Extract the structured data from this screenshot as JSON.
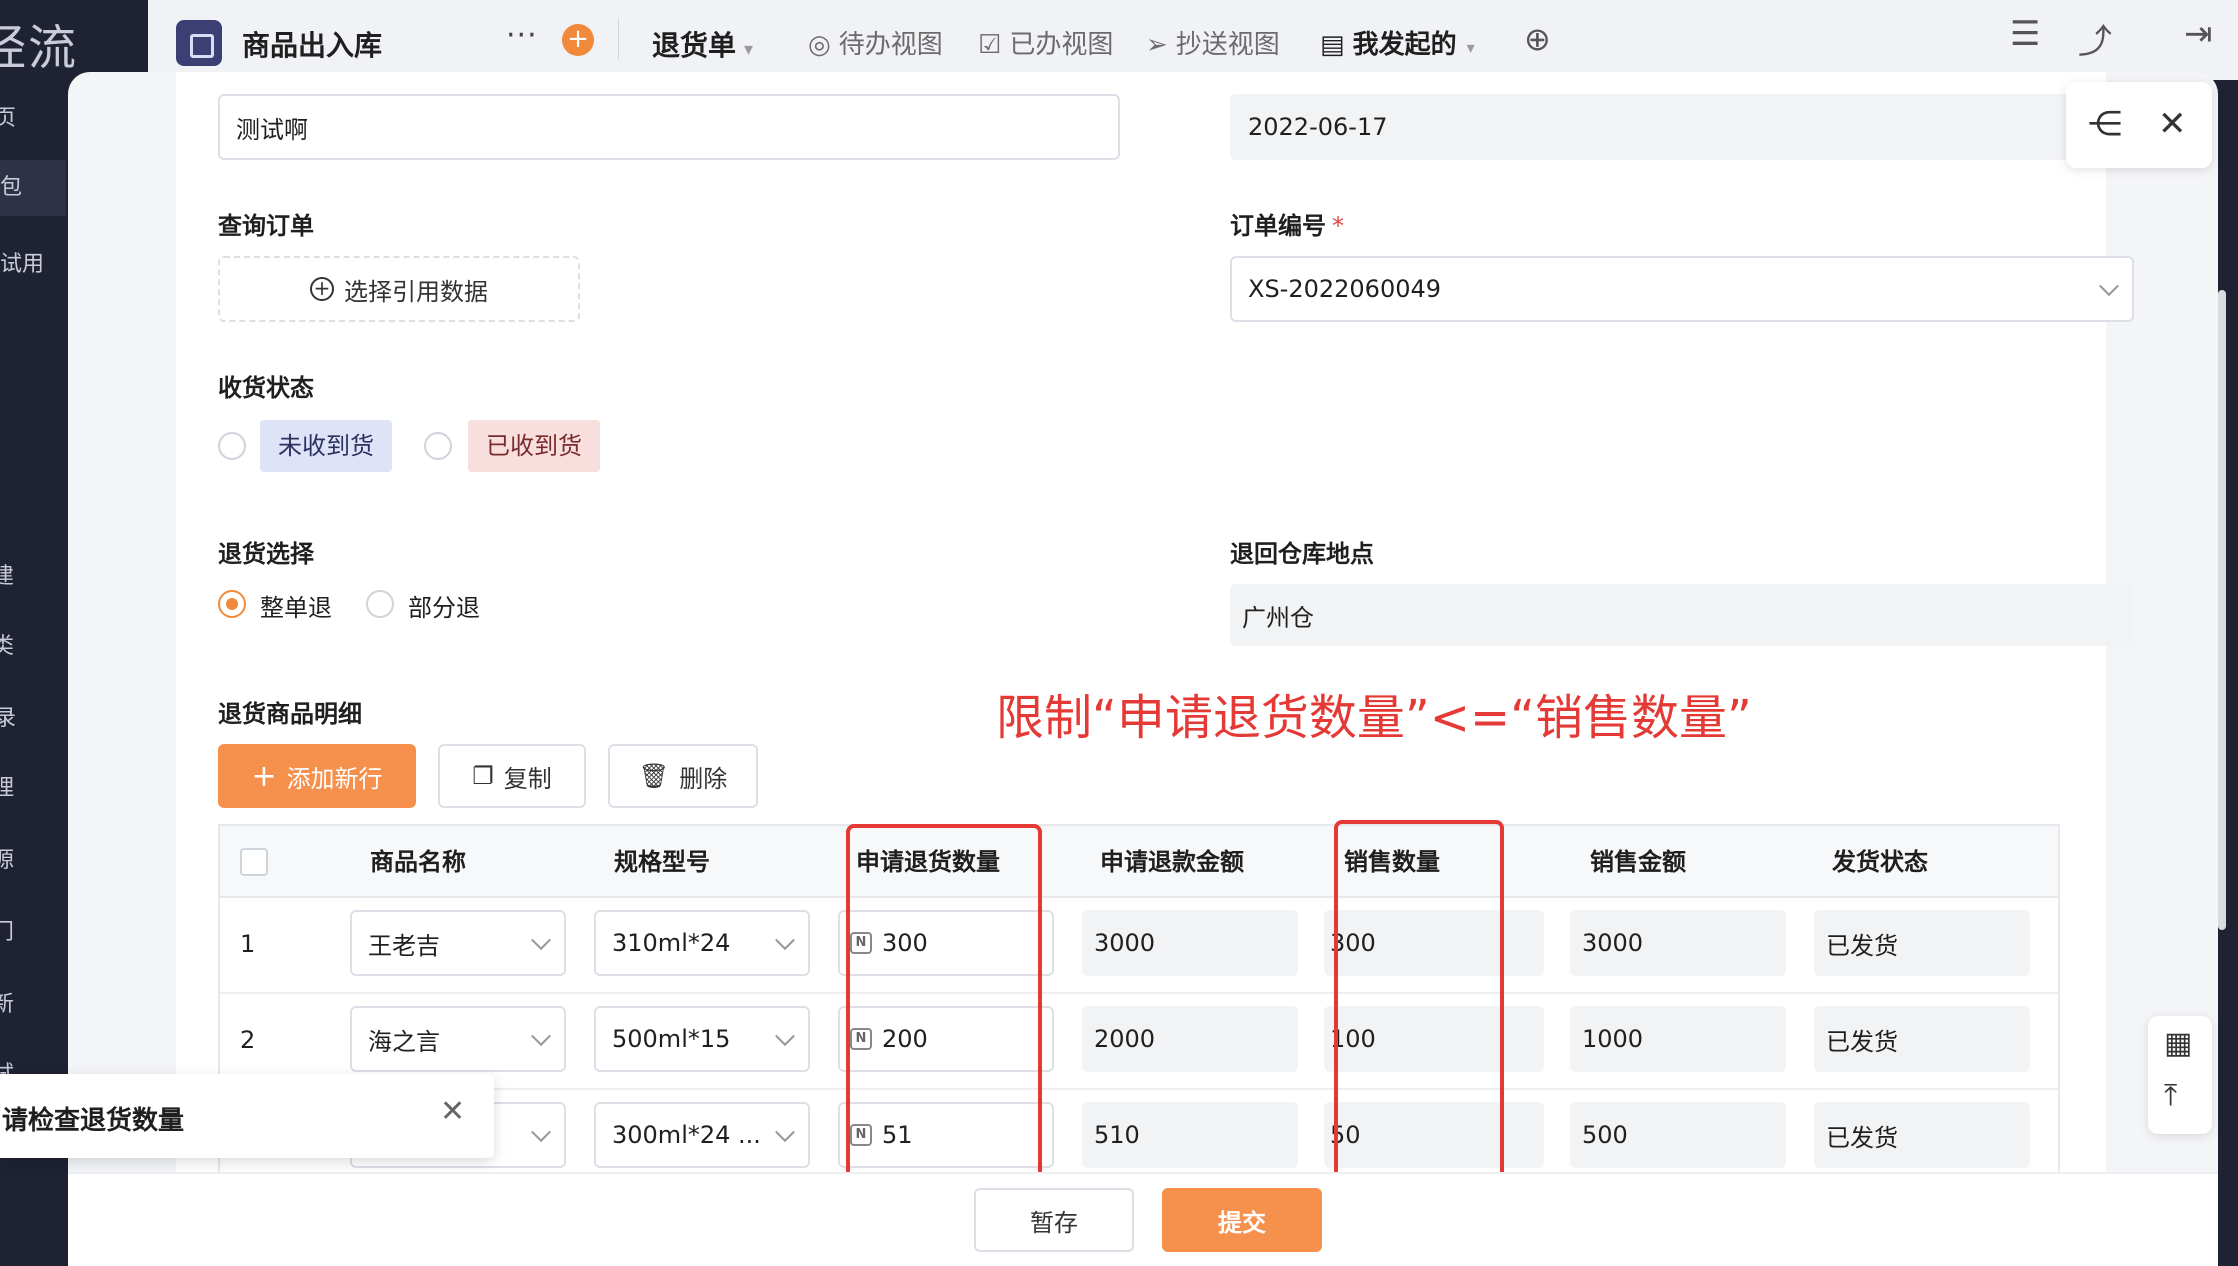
{
  "sidebar": {
    "brand": "经流",
    "items": [
      "页",
      "包",
      "试用",
      "建",
      "类",
      "录",
      "理",
      "源",
      "门",
      "新",
      "试"
    ]
  },
  "topbar": {
    "app_title": "商品出入库",
    "more": "···",
    "main_view": "退货单",
    "views": [
      "待办视图",
      "已办视图",
      "抄送视图",
      "我发起的"
    ]
  },
  "form": {
    "top_left_value": "测试啊",
    "top_right_value": "2022-06-17",
    "query_order_label": "查询订单",
    "select_ref_label": "选择引用数据",
    "order_no_label": "订单编号",
    "order_no_value": "XS-2022060049",
    "receipt_status_label": "收货状态",
    "receipt_options": [
      "未收到货",
      "已收到货"
    ],
    "return_choice_label": "退货选择",
    "return_options": [
      "整单退",
      "部分退"
    ],
    "return_choice_selected": "整单退",
    "warehouse_label": "退回仓库地点",
    "warehouse_value": "广州仓",
    "detail_label": "退货商品明细"
  },
  "annotation": "限制“申请退货数量”<=“销售数量”",
  "toolbar": {
    "add_row": "添加新行",
    "copy": "复制",
    "delete": "删除"
  },
  "table": {
    "headers": [
      "商品名称",
      "规格型号",
      "申请退货数量",
      "申请退款金额",
      "销售数量",
      "销售金额",
      "发货状态"
    ],
    "rows": [
      {
        "idx": "1",
        "name": "王老吉",
        "spec": "310ml*24",
        "return_qty": "300",
        "refund": "3000",
        "sale_qty": "300",
        "sale_amount": "3000",
        "ship": "已发货"
      },
      {
        "idx": "2",
        "name": "海之言",
        "spec": "500ml*15",
        "return_qty": "200",
        "refund": "2000",
        "sale_qty": "100",
        "sale_amount": "1000",
        "ship": "已发货"
      },
      {
        "idx": "",
        "name": "",
        "spec": "300ml*24 ...",
        "return_qty": "51",
        "refund": "510",
        "sale_qty": "50",
        "sale_amount": "500",
        "ship": "已发货"
      }
    ]
  },
  "footer": {
    "save": "暂存",
    "submit": "提交"
  },
  "toast": {
    "message": "请检查退货数量"
  },
  "colors": {
    "accent": "#f5914d",
    "annotation": "#e53935",
    "sidebar": "#1f2233"
  }
}
